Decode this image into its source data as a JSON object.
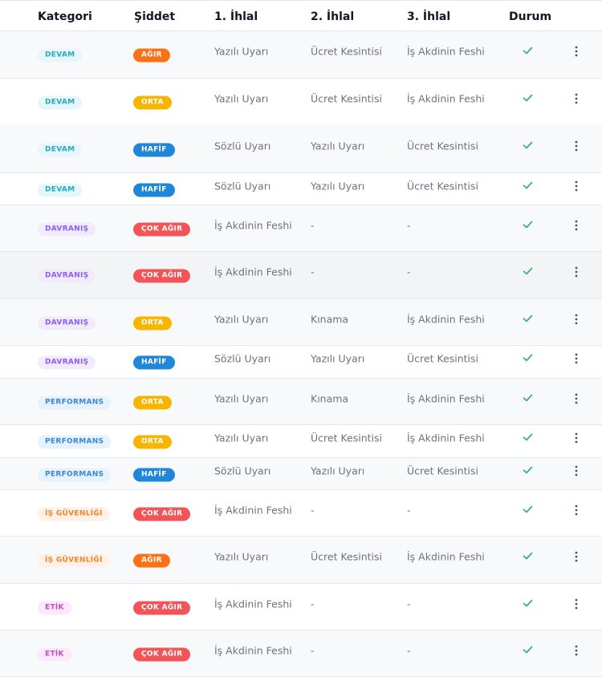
{
  "colors": {
    "check": "#34b07a",
    "menu": "#4b5563",
    "row_alt": "#f8f9fb",
    "row_highlight": "#f3f4f6"
  },
  "header": {
    "category": "Kategori",
    "severity": "Şiddet",
    "first": "1. İhlal",
    "second": "2. İhlal",
    "third": "3. İhlal",
    "status": "Durum"
  },
  "category_styles": {
    "DEVAM": {
      "bg": "#e6f6fa",
      "fg": "#27a9c4"
    },
    "DAVRANIŞ": {
      "bg": "#f1ebfc",
      "fg": "#8b5cf6"
    },
    "PERFORMANS": {
      "bg": "#e8f2fd",
      "fg": "#3a87d8"
    },
    "İŞ GÜVENLİĞİ": {
      "bg": "#fef1e7",
      "fg": "#f2852c"
    },
    "ETİK": {
      "bg": "#fbe9fb",
      "fg": "#c44ac8"
    }
  },
  "severity_styles": {
    "AĞIR": "#f97316",
    "ORTA": "#f7b500",
    "HAFİF": "#1f86d9",
    "ÇOK AĞIR": "#f25558"
  },
  "rows": [
    {
      "category": "DEVAM",
      "severity": "AĞIR",
      "first": "Yazılı Uyarı",
      "second": "Ücret Kesintisi",
      "third": "İş Akdinin Feshi",
      "status_icon": "check-icon"
    },
    {
      "category": "DEVAM",
      "severity": "ORTA",
      "first": "Yazılı Uyarı",
      "second": "Ücret Kesintisi",
      "third": "İş Akdinin Feshi",
      "status_icon": "check-icon"
    },
    {
      "category": "DEVAM",
      "severity": "HAFİF",
      "first": "Sözlü Uyarı",
      "second": "Yazılı Uyarı",
      "third": "Ücret Kesintisi",
      "status_icon": "check-icon"
    },
    {
      "category": "DEVAM",
      "severity": "HAFİF",
      "first": "Sözlü Uyarı",
      "second": "Yazılı Uyarı",
      "third": "Ücret Kesintisi",
      "status_icon": "check-icon"
    },
    {
      "category": "DAVRANIŞ",
      "severity": "ÇOK AĞIR",
      "first": "İş Akdinin Feshi",
      "second": "-",
      "third": "-",
      "status_icon": "check-icon"
    },
    {
      "category": "DAVRANIŞ",
      "severity": "ÇOK AĞIR",
      "first": "İş Akdinin Feshi",
      "second": "-",
      "third": "-",
      "status_icon": "check-icon"
    },
    {
      "category": "DAVRANIŞ",
      "severity": "ORTA",
      "first": "Yazılı Uyarı",
      "second": "Kınama",
      "third": "İş Akdinin Feshi",
      "status_icon": "check-icon"
    },
    {
      "category": "DAVRANIŞ",
      "severity": "HAFİF",
      "first": "Sözlü Uyarı",
      "second": "Yazılı Uyarı",
      "third": "Ücret Kesintisi",
      "status_icon": "check-icon"
    },
    {
      "category": "PERFORMANS",
      "severity": "ORTA",
      "first": "Yazılı Uyarı",
      "second": "Kınama",
      "third": "İş Akdinin Feshi",
      "status_icon": "check-icon"
    },
    {
      "category": "PERFORMANS",
      "severity": "ORTA",
      "first": "Yazılı Uyarı",
      "second": "Ücret Kesintisi",
      "third": "İş Akdinin Feshi",
      "status_icon": "check-icon"
    },
    {
      "category": "PERFORMANS",
      "severity": "HAFİF",
      "first": "Sözlü Uyarı",
      "second": "Yazılı Uyarı",
      "third": "Ücret Kesintisi",
      "status_icon": "check-icon"
    },
    {
      "category": "İŞ GÜVENLİĞİ",
      "severity": "ÇOK AĞIR",
      "first": "İş Akdinin Feshi",
      "second": "-",
      "third": "-",
      "status_icon": "check-icon"
    },
    {
      "category": "İŞ GÜVENLİĞİ",
      "severity": "AĞIR",
      "first": "Yazılı Uyarı",
      "second": "Ücret Kesintisi",
      "third": "İş Akdinin Feshi",
      "status_icon": "check-icon"
    },
    {
      "category": "ETİK",
      "severity": "ÇOK AĞIR",
      "first": "İş Akdinin Feshi",
      "second": "-",
      "third": "-",
      "status_icon": "check-icon"
    },
    {
      "category": "ETİK",
      "severity": "ÇOK AĞIR",
      "first": "İş Akdinin Feshi",
      "second": "-",
      "third": "-",
      "status_icon": "check-icon"
    }
  ]
}
